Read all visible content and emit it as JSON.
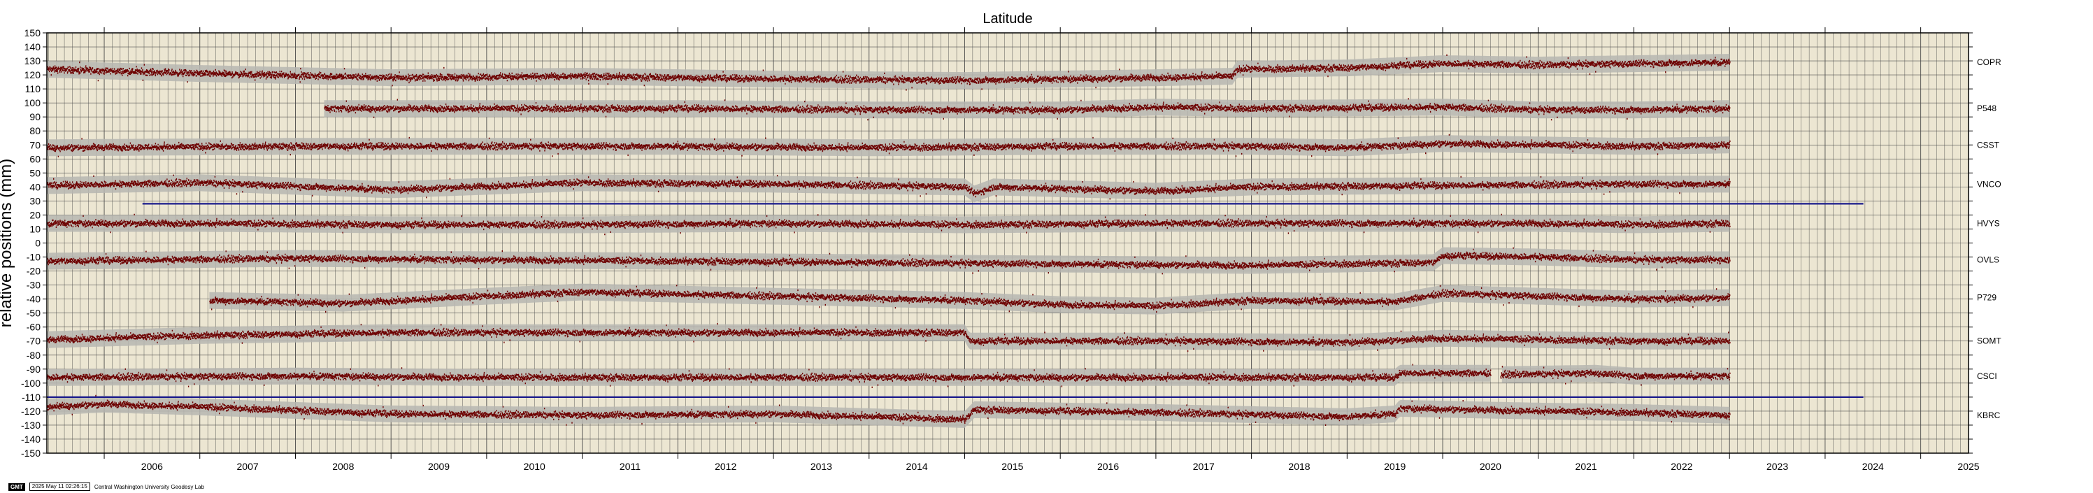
{
  "chart_data": {
    "type": "scatter",
    "title": "Latitude",
    "ylabel": "relative positions (mm)",
    "xlabel": "",
    "xlim": [
      2005.4,
      2025.5
    ],
    "ylim": [
      -150,
      150
    ],
    "y_ticks": [
      150,
      140,
      130,
      120,
      110,
      100,
      90,
      80,
      70,
      60,
      50,
      40,
      30,
      20,
      10,
      0,
      -10,
      -20,
      -30,
      -40,
      -50,
      -60,
      -70,
      -80,
      -90,
      -100,
      -110,
      -120,
      -130,
      -140,
      -150
    ],
    "x_ticks": [
      "2006",
      "2007",
      "2008",
      "2009",
      "2010",
      "2011",
      "2012",
      "2013",
      "2014",
      "2015",
      "2016",
      "2017",
      "2018",
      "2019",
      "2020",
      "2021",
      "2022",
      "2023",
      "2024",
      "2025"
    ],
    "grid": true,
    "series": [
      {
        "name": "COPR",
        "start": 2005.4,
        "end": 2023.0,
        "points": [
          [
            2005.4,
            124
          ],
          [
            2007,
            121
          ],
          [
            2009,
            118
          ],
          [
            2011,
            119
          ],
          [
            2013,
            117
          ],
          [
            2015,
            116
          ],
          [
            2017,
            118
          ],
          [
            2017.8,
            119
          ],
          [
            2017.85,
            124
          ],
          [
            2019,
            125
          ],
          [
            2020,
            128
          ],
          [
            2021,
            127
          ],
          [
            2022,
            128
          ],
          [
            2023,
            129
          ]
        ]
      },
      {
        "name": "P548",
        "start": 2008.3,
        "end": 2023.0,
        "points": [
          [
            2008.3,
            96
          ],
          [
            2010,
            96
          ],
          [
            2012,
            96
          ],
          [
            2014,
            95
          ],
          [
            2016,
            95
          ],
          [
            2017,
            97
          ],
          [
            2018,
            96
          ],
          [
            2020,
            97
          ],
          [
            2021,
            95
          ],
          [
            2022,
            95
          ],
          [
            2023,
            96
          ]
        ]
      },
      {
        "name": "CSST",
        "start": 2005.4,
        "end": 2023.0,
        "points": [
          [
            2005.4,
            68
          ],
          [
            2008,
            69
          ],
          [
            2010,
            69
          ],
          [
            2012,
            69
          ],
          [
            2014,
            68
          ],
          [
            2016,
            69
          ],
          [
            2018,
            69
          ],
          [
            2019,
            68
          ],
          [
            2020,
            71
          ],
          [
            2021,
            70
          ],
          [
            2022,
            69
          ],
          [
            2023,
            70
          ]
        ]
      },
      {
        "name": "VNCO",
        "start": 2005.4,
        "end": 2023.0,
        "points": [
          [
            2005.4,
            41
          ],
          [
            2007,
            43
          ],
          [
            2009,
            38
          ],
          [
            2011,
            43
          ],
          [
            2013,
            42
          ],
          [
            2015,
            40
          ],
          [
            2015.1,
            35
          ],
          [
            2015.3,
            40
          ],
          [
            2017,
            37
          ],
          [
            2018,
            40
          ],
          [
            2020,
            41
          ],
          [
            2022,
            42
          ],
          [
            2023,
            42
          ]
        ]
      },
      {
        "name": "HVYS",
        "start": 2005.4,
        "end": 2023.0,
        "points": [
          [
            2005.4,
            14
          ],
          [
            2007,
            14
          ],
          [
            2009,
            13
          ],
          [
            2011,
            13
          ],
          [
            2013,
            14
          ],
          [
            2015,
            13
          ],
          [
            2017,
            14
          ],
          [
            2018,
            14
          ],
          [
            2020,
            14
          ],
          [
            2021,
            14
          ],
          [
            2022,
            13
          ],
          [
            2023,
            14
          ]
        ]
      },
      {
        "name": "OVLS",
        "start": 2005.4,
        "end": 2023.0,
        "points": [
          [
            2005.4,
            -13
          ],
          [
            2008,
            -11
          ],
          [
            2010,
            -12
          ],
          [
            2012,
            -13
          ],
          [
            2014,
            -14
          ],
          [
            2016,
            -15
          ],
          [
            2018,
            -16
          ],
          [
            2019.9,
            -14
          ],
          [
            2020,
            -9
          ],
          [
            2021,
            -10
          ],
          [
            2022,
            -12
          ],
          [
            2023,
            -12
          ]
        ]
      },
      {
        "name": "P729",
        "start": 2007.1,
        "end": 2023.0,
        "points": [
          [
            2007.1,
            -41
          ],
          [
            2008.5,
            -43
          ],
          [
            2010,
            -38
          ],
          [
            2011,
            -35
          ],
          [
            2013,
            -38
          ],
          [
            2015,
            -41
          ],
          [
            2016,
            -44
          ],
          [
            2017,
            -45
          ],
          [
            2018,
            -41
          ],
          [
            2019.5,
            -42
          ],
          [
            2020,
            -36
          ],
          [
            2021,
            -38
          ],
          [
            2022,
            -40
          ],
          [
            2023,
            -39
          ]
        ]
      },
      {
        "name": "SOMT",
        "start": 2005.4,
        "end": 2023.0,
        "points": [
          [
            2005.4,
            -69
          ],
          [
            2007,
            -66
          ],
          [
            2009,
            -64
          ],
          [
            2011,
            -64
          ],
          [
            2013,
            -64
          ],
          [
            2015,
            -64
          ],
          [
            2015.05,
            -70
          ],
          [
            2017,
            -70
          ],
          [
            2019,
            -71
          ],
          [
            2020,
            -68
          ],
          [
            2021,
            -69
          ],
          [
            2022,
            -70
          ],
          [
            2023,
            -70
          ]
        ]
      },
      {
        "name": "CSCI",
        "start": 2005.4,
        "end": 2023.0,
        "points": [
          [
            2005.4,
            -96
          ],
          [
            2008,
            -95
          ],
          [
            2010,
            -96
          ],
          [
            2012,
            -96
          ],
          [
            2014,
            -96
          ],
          [
            2016,
            -96
          ],
          [
            2018,
            -96
          ],
          [
            2019.5,
            -96
          ],
          [
            2019.55,
            -93
          ],
          [
            2020.5,
            -93
          ],
          [
            2020.6,
            null
          ],
          [
            2020.6,
            -94
          ],
          [
            2021.6,
            -93
          ],
          [
            2022,
            -95
          ],
          [
            2023,
            -95
          ]
        ]
      },
      {
        "name": "KBRC",
        "start": 2005.4,
        "end": 2023.0,
        "points": [
          [
            2005.4,
            -117
          ],
          [
            2006,
            -115
          ],
          [
            2007,
            -117
          ],
          [
            2009,
            -122
          ],
          [
            2011,
            -123
          ],
          [
            2013,
            -122
          ],
          [
            2015,
            -126
          ],
          [
            2015.1,
            -119
          ],
          [
            2017,
            -121
          ],
          [
            2019,
            -124
          ],
          [
            2019.5,
            -122
          ],
          [
            2019.55,
            -118
          ],
          [
            2021,
            -120
          ],
          [
            2022,
            -121
          ],
          [
            2023,
            -123
          ]
        ]
      }
    ],
    "reference_lines": [
      {
        "y": 28,
        "x": [
          2006.4,
          2024.4
        ],
        "color": "#1a1a8c"
      },
      {
        "y": -110,
        "x": [
          2005.4,
          2024.4
        ],
        "color": "#1a1a8c"
      }
    ],
    "colors": {
      "background": "#ece6d2",
      "grid": "#4a4a4a",
      "points": "#6d0000",
      "band": "#b7b6b1",
      "reference": "#1a1a8c"
    }
  },
  "footer": {
    "logo": "GMT",
    "timestamp": "2025 May 11 02:26:15",
    "credit": "Central Washington University Geodesy Lab"
  }
}
